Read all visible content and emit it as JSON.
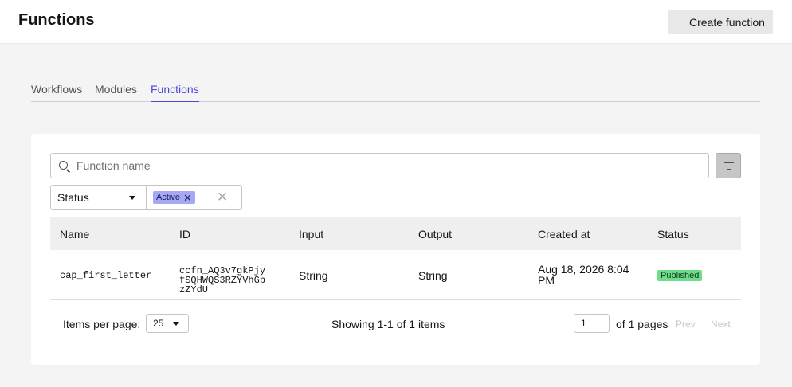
{
  "header": {
    "title": "Functions",
    "create_button_label": "Create function"
  },
  "tabs": [
    {
      "label": "Workflows",
      "active": false
    },
    {
      "label": "Modules",
      "active": false
    },
    {
      "label": "Functions",
      "active": true
    }
  ],
  "search": {
    "placeholder": "Function name",
    "value": ""
  },
  "filter": {
    "field_label": "Status",
    "tags": [
      "Active"
    ]
  },
  "table": {
    "columns": [
      "Name",
      "ID",
      "Input",
      "Output",
      "Created at",
      "Status"
    ],
    "rows": [
      {
        "name": "cap_first_letter",
        "id": "ccfn_AQ3v7gkPjyfSQHWQS3RZYVhGpzZYdU",
        "input": "String",
        "output": "String",
        "created_at": "Aug 18, 2026 8:04 PM",
        "status": "Published"
      }
    ]
  },
  "pagination": {
    "items_per_page_label": "Items per page:",
    "items_per_page": "25",
    "showing": "Showing 1-1 of 1 items",
    "current_page": "1",
    "of_pages": "of 1 pages",
    "prev_label": "Prev",
    "next_label": "Next"
  },
  "colors": {
    "accent": "#4a4ad9",
    "tag_bg": "#a6a8f2",
    "published_badge": "#6fdc8c"
  },
  "icons": [
    "plus-icon",
    "search-icon",
    "filter-icon",
    "caret-down-icon",
    "close-icon"
  ]
}
